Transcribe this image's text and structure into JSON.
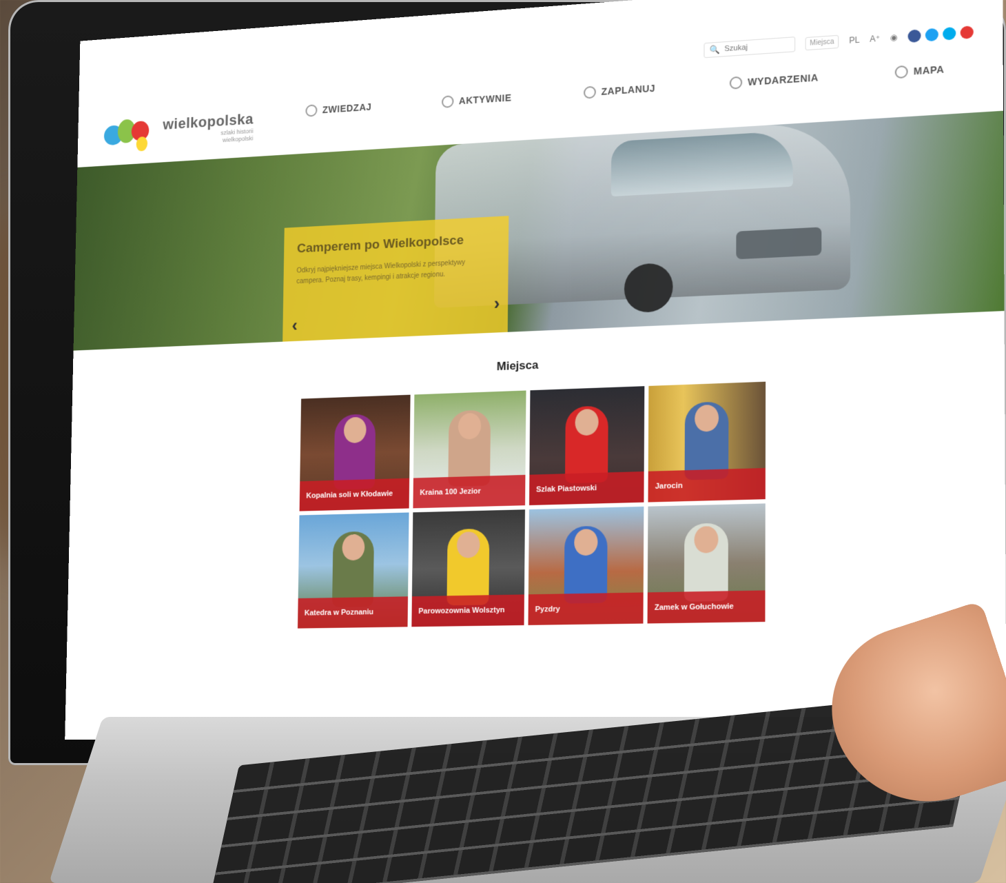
{
  "site": {
    "logo_text": "wielkopolska",
    "logo_sub_line1": "szlaki historii",
    "logo_sub_line2": "wielkopolski"
  },
  "utility": {
    "search_placeholder": "Szukaj",
    "select_label": "Miejsca",
    "lang": "PL",
    "font_size": "A⁺",
    "contrast": "◉"
  },
  "nav": [
    {
      "label": "ZWIEDZAJ",
      "icon": "compass-icon"
    },
    {
      "label": "AKTYWNIE",
      "icon": "runner-icon"
    },
    {
      "label": "ZAPLANUJ",
      "icon": "route-icon"
    },
    {
      "label": "WYDARZENIA",
      "icon": "calendar-icon"
    },
    {
      "label": "MAPA",
      "icon": "map-pin-icon"
    }
  ],
  "hero": {
    "title": "Camperem po Wielkopolsce",
    "text": "Odkryj najpiękniejsze miejsca Wielkopolski z perspektywy campera. Poznaj trasy, kempingi i atrakcje regionu.",
    "prev": "‹",
    "next": "›"
  },
  "places": {
    "title": "Miejsca",
    "tiles": [
      {
        "label": "Kopalnia soli w Kłodawie"
      },
      {
        "label": "Kraina 100 Jezior"
      },
      {
        "label": "Szlak Piastowski"
      },
      {
        "label": "Jarocin"
      },
      {
        "label": "Katedra w Poznaniu"
      },
      {
        "label": "Parowozownia Wolsztyn"
      },
      {
        "label": "Pyzdry"
      },
      {
        "label": "Zamek w Gołuchowie"
      }
    ]
  },
  "colors": {
    "accent_red": "#c81e24",
    "hero_yellow": "#f3cd29",
    "social": [
      "#3b5998",
      "#1da1f2",
      "#00aced",
      "#e53935"
    ]
  }
}
